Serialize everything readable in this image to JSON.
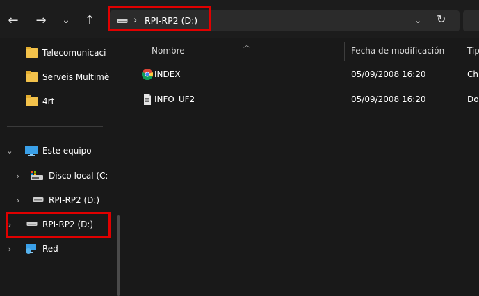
{
  "toolbar": {
    "back_icon": "arrow-left-icon",
    "forward_icon": "arrow-right-icon",
    "recent_icon": "chevron-down-icon",
    "up_icon": "arrow-up-icon",
    "back_glyph": "←",
    "forward_glyph": "→",
    "recent_glyph": "⌄",
    "up_glyph": "↑"
  },
  "address": {
    "separator": "›",
    "path": "RPI-RP2 (D:)",
    "dropdown_glyph": "⌄",
    "refresh_glyph": "↻"
  },
  "sidebar": {
    "items": [
      {
        "label": "Telecomunicaci",
        "icon": "folder-icon"
      },
      {
        "label": "Serveis Multimè",
        "icon": "folder-icon"
      },
      {
        "label": "4rt",
        "icon": "folder-icon"
      },
      {
        "label": "Este equipo",
        "icon": "computer-icon",
        "expanded": true
      },
      {
        "label": "Disco local (C:",
        "icon": "local-disk-icon"
      },
      {
        "label": "RPI-RP2 (D:)",
        "icon": "drive-icon"
      },
      {
        "label": "RPI-RP2 (D:)",
        "icon": "drive-icon",
        "highlighted": true
      },
      {
        "label": "Red",
        "icon": "network-icon"
      }
    ]
  },
  "columns": {
    "name": "Nombre",
    "date": "Fecha de modificación",
    "type": "Tip"
  },
  "files": [
    {
      "name": "INDEX",
      "date": "05/09/2008 16:20",
      "type": "Ch",
      "icon": "chrome-icon"
    },
    {
      "name": "INFO_UF2",
      "date": "05/09/2008 16:20",
      "type": "Do",
      "icon": "text-document-icon"
    }
  ],
  "colors": {
    "background": "#191919",
    "highlight": "#e00000",
    "folder": "#f3c24b"
  }
}
